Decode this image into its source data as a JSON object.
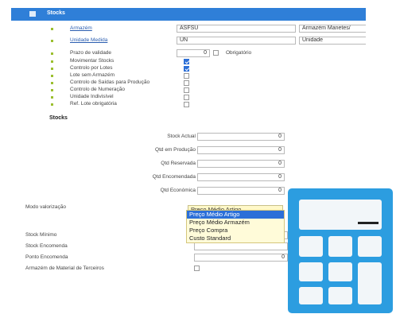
{
  "window": {
    "title": "Stocks"
  },
  "fields": {
    "armazem": {
      "label": "Armazém",
      "value": "ASFSU",
      "description": "Armazém Manetes/"
    },
    "unidade_medida": {
      "label": "Unidade Medida",
      "value": "UN",
      "description": "Unidade"
    },
    "prazo_validade": {
      "label": "Prazo de validade",
      "value": "0",
      "obrigatorio_label": "Obrigatório"
    }
  },
  "checkboxes": [
    {
      "label": "Movimentar Stocks",
      "checked": true
    },
    {
      "label": "Controlo por Lotes",
      "checked": true
    },
    {
      "label": "Lote sem Armazém",
      "checked": false
    },
    {
      "label": "Controlo de Saídas para Produção",
      "checked": false
    },
    {
      "label": "Controlo de Numeração",
      "checked": false
    },
    {
      "label": "Unidade Indivisível",
      "checked": false
    },
    {
      "label": "Ref. Lote obrigatória",
      "checked": false
    }
  ],
  "stocks_section": {
    "title": "Stocks",
    "rows": [
      {
        "label": "Stock Actual",
        "value": "0"
      },
      {
        "label": "Qtd em Produção",
        "value": "0"
      },
      {
        "label": "Qtd Reservada",
        "value": "0"
      },
      {
        "label": "Qtd Encomendada",
        "value": "0"
      },
      {
        "label": "Qtd Económica",
        "value": "0"
      }
    ]
  },
  "valorizacao": {
    "label": "Modo valorização",
    "selected": "Preço Médio Artigo",
    "options": [
      "Preço Médio Artigo",
      "Preço Médio Armazém",
      "Preço Compra",
      "Custo Standard"
    ],
    "highlighted": "Preço Médio Artigo"
  },
  "lower_fields": {
    "stock_minimo": {
      "label": "Stock Mínimo"
    },
    "stock_encomenda": {
      "label": "Stock Encomenda"
    },
    "ponto_encomenda": {
      "label": "Ponto Encomenda",
      "value": "0"
    },
    "armazem_terceiros": {
      "label": "Armazém de Material de Terceiros"
    }
  },
  "colors": {
    "titlebar": "#2f7fd8",
    "calculator": "#2c9de0",
    "dropdown_highlight": "#2b6fd8"
  }
}
